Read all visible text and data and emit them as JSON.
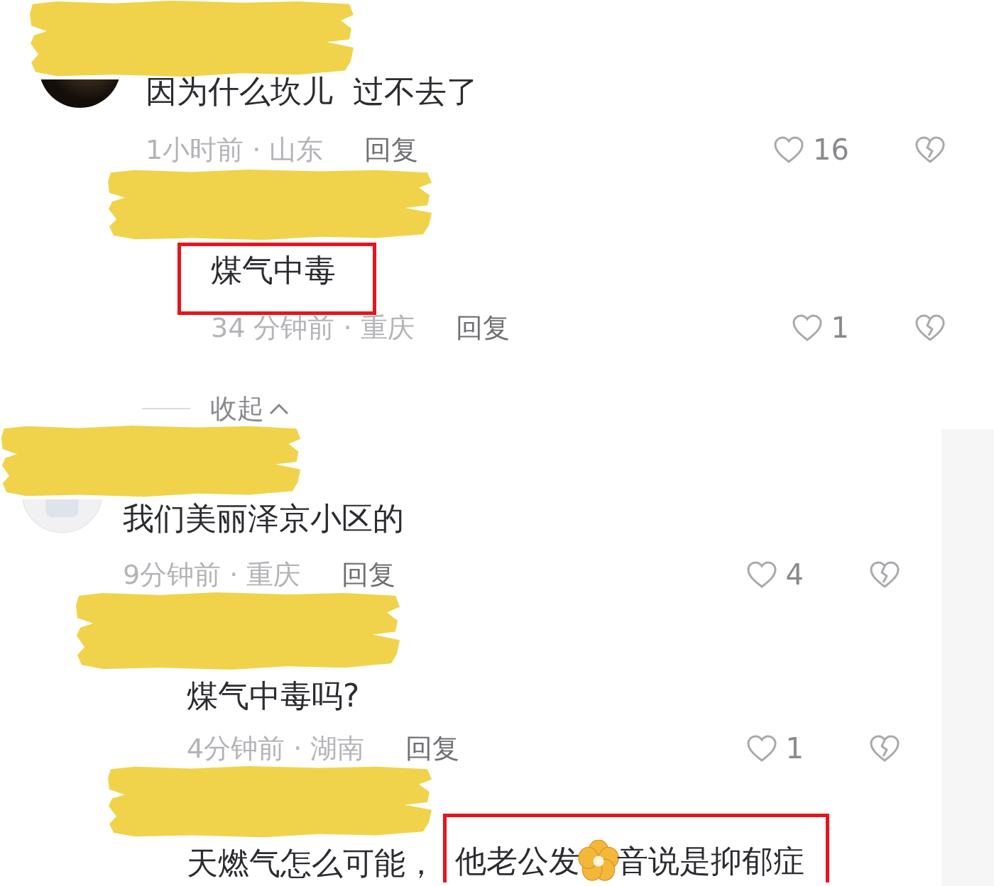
{
  "comments": [
    {
      "avatar": {
        "kind": "dark"
      },
      "name_redacted": true,
      "body": [
        {
          "kind": "plain",
          "text": "因为什么坎儿  过不去了"
        }
      ],
      "time": "1小时前 · 山东",
      "reply": "回复",
      "likes": "16",
      "replies": [
        {
          "name_redacted": true,
          "body": [
            {
              "kind": "boxed",
              "parts": [
                {
                  "kind": "text",
                  "text": "煤气中毒"
                }
              ]
            }
          ],
          "time": "34 分钟前 · 重庆",
          "reply": "回复",
          "likes": "1"
        }
      ],
      "collapse": {
        "label": "收起"
      }
    },
    {
      "avatar": {
        "kind": "light"
      },
      "name_redacted": true,
      "body": [
        {
          "kind": "plain",
          "text": "我们美丽泽京小区的"
        }
      ],
      "time": "9分钟前 · 重庆",
      "reply": "回复",
      "likes": "4",
      "replies": [
        {
          "name_redacted": true,
          "body": [
            {
              "kind": "plain",
              "text": "煤气中毒吗?"
            }
          ],
          "time": "4分钟前 · 湖南",
          "reply": "回复",
          "likes": "1"
        },
        {
          "name_redacted": true,
          "body": [
            {
              "kind": "plain",
              "text": "天燃气怎么可能，"
            },
            {
              "kind": "boxed",
              "parts": [
                {
                  "kind": "text",
                  "text": "他老公发"
                },
                {
                  "kind": "sticker"
                },
                {
                  "kind": "text",
                  "text": "音说是抑郁症"
                }
              ]
            }
          ]
        }
      ]
    }
  ]
}
